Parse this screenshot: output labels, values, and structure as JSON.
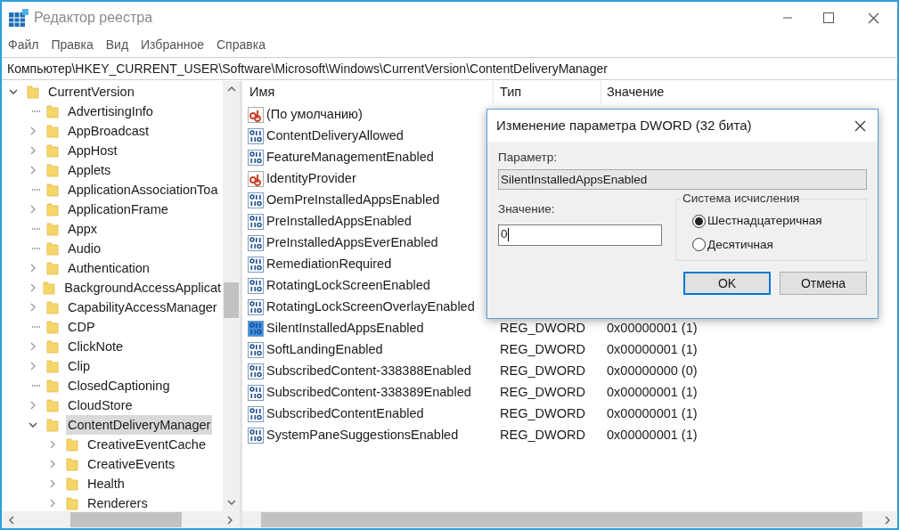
{
  "window": {
    "title": "Редактор реестра"
  },
  "menu": [
    "Файл",
    "Правка",
    "Вид",
    "Избранное",
    "Справка"
  ],
  "address": "Компьютер\\HKEY_CURRENT_USER\\Software\\Microsoft\\Windows\\CurrentVersion\\ContentDeliveryManager",
  "tree": [
    {
      "name": "CurrentVersion",
      "expandable": true,
      "expanded": true,
      "selected": false,
      "children": [
        {
          "name": "AdvertisingInfo",
          "expandable": false,
          "expanded": false,
          "selected": false
        },
        {
          "name": "AppBroadcast",
          "expandable": true,
          "expanded": false,
          "selected": false
        },
        {
          "name": "AppHost",
          "expandable": true,
          "expanded": false,
          "selected": false
        },
        {
          "name": "Applets",
          "expandable": true,
          "expanded": false,
          "selected": false
        },
        {
          "name": "ApplicationAssociationToa",
          "expandable": false,
          "expanded": false,
          "selected": false
        },
        {
          "name": "ApplicationFrame",
          "expandable": true,
          "expanded": false,
          "selected": false
        },
        {
          "name": "Appx",
          "expandable": false,
          "expanded": false,
          "selected": false
        },
        {
          "name": "Audio",
          "expandable": false,
          "expanded": false,
          "selected": false
        },
        {
          "name": "Authentication",
          "expandable": true,
          "expanded": false,
          "selected": false
        },
        {
          "name": "BackgroundAccessApplicat",
          "expandable": true,
          "expanded": false,
          "selected": false
        },
        {
          "name": "CapabilityAccessManager",
          "expandable": true,
          "expanded": false,
          "selected": false
        },
        {
          "name": "CDP",
          "expandable": false,
          "expanded": false,
          "selected": false
        },
        {
          "name": "ClickNote",
          "expandable": true,
          "expanded": false,
          "selected": false
        },
        {
          "name": "Clip",
          "expandable": true,
          "expanded": false,
          "selected": false
        },
        {
          "name": "ClosedCaptioning",
          "expandable": false,
          "expanded": false,
          "selected": false
        },
        {
          "name": "CloudStore",
          "expandable": true,
          "expanded": false,
          "selected": false
        },
        {
          "name": "ContentDeliveryManager",
          "expandable": true,
          "expanded": true,
          "selected": true,
          "children": [
            {
              "name": "CreativeEventCache",
              "expandable": true,
              "expanded": false,
              "selected": false
            },
            {
              "name": "CreativeEvents",
              "expandable": true,
              "expanded": false,
              "selected": false
            },
            {
              "name": "Health",
              "expandable": true,
              "expanded": false,
              "selected": false
            },
            {
              "name": "Renderers",
              "expandable": true,
              "expanded": false,
              "selected": false
            }
          ]
        }
      ]
    }
  ],
  "columns": [
    "Имя",
    "Тип",
    "Значение"
  ],
  "rows": [
    {
      "kind": "string",
      "name": "(По умолчанию)",
      "selected": false
    },
    {
      "kind": "dword",
      "name": "ContentDeliveryAllowed",
      "selected": false
    },
    {
      "kind": "dword",
      "name": "FeatureManagementEnabled",
      "selected": false
    },
    {
      "kind": "string",
      "name": "IdentityProvider",
      "selected": false
    },
    {
      "kind": "dword",
      "name": "OemPreInstalledAppsEnabled",
      "selected": false
    },
    {
      "kind": "dword",
      "name": "PreInstalledAppsEnabled",
      "selected": false
    },
    {
      "kind": "dword",
      "name": "PreInstalledAppsEverEnabled",
      "selected": false
    },
    {
      "kind": "dword",
      "name": "RemediationRequired",
      "selected": false
    },
    {
      "kind": "dword",
      "name": "RotatingLockScreenEnabled",
      "selected": false
    },
    {
      "kind": "dword",
      "name": "RotatingLockScreenOverlayEnabled",
      "selected": false
    },
    {
      "kind": "dword",
      "name": "SilentInstalledAppsEnabled",
      "type": "REG_DWORD",
      "data": "0x00000001 (1)",
      "selected": true
    },
    {
      "kind": "dword",
      "name": "SoftLandingEnabled",
      "type": "REG_DWORD",
      "data": "0x00000001 (1)",
      "selected": false
    },
    {
      "kind": "dword",
      "name": "SubscribedContent-338388Enabled",
      "type": "REG_DWORD",
      "data": "0x00000000 (0)",
      "selected": false
    },
    {
      "kind": "dword",
      "name": "SubscribedContent-338389Enabled",
      "type": "REG_DWORD",
      "data": "0x00000001 (1)",
      "selected": false
    },
    {
      "kind": "dword",
      "name": "SubscribedContentEnabled",
      "type": "REG_DWORD",
      "data": "0x00000001 (1)",
      "selected": false
    },
    {
      "kind": "dword",
      "name": "SystemPaneSuggestionsEnabled",
      "type": "REG_DWORD",
      "data": "0x00000001 (1)",
      "selected": false
    }
  ],
  "dialog": {
    "title": "Изменение параметра DWORD (32 бита)",
    "name_label": "Параметр:",
    "name_value": "SilentInstalledAppsEnabled",
    "value_label": "Значение:",
    "value": "0",
    "base_group": "Система исчисления",
    "bases": [
      {
        "label": "Шестнадцатеричная",
        "selected": true
      },
      {
        "label": "Десятичная",
        "selected": false
      }
    ],
    "buttons": [
      {
        "label": "OK",
        "default": true
      },
      {
        "label": "Отмена",
        "default": false
      }
    ]
  }
}
